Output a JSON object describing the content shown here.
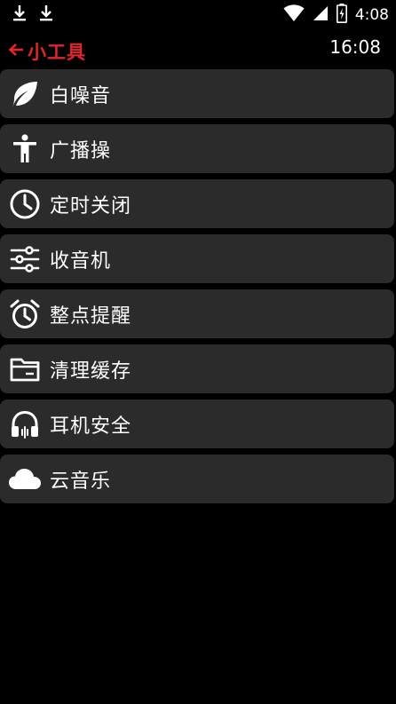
{
  "status_bar": {
    "time": "4:08",
    "left_icons": [
      "download-icon",
      "download-icon"
    ],
    "right_icons": [
      "wifi-icon",
      "battery-charging-icon"
    ]
  },
  "header": {
    "title": "小工具",
    "clock": "16:08",
    "accent_color": "#e0262b"
  },
  "items": [
    {
      "label": "白噪音",
      "icon": "leaf-icon"
    },
    {
      "label": "广播操",
      "icon": "person-icon"
    },
    {
      "label": "定时关闭",
      "icon": "clock-icon"
    },
    {
      "label": "收音机",
      "icon": "sliders-icon"
    },
    {
      "label": "整点提醒",
      "icon": "alarm-icon"
    },
    {
      "label": "清理缓存",
      "icon": "folder-icon"
    },
    {
      "label": "耳机安全",
      "icon": "headphones-icon"
    },
    {
      "label": "云音乐",
      "icon": "cloud-icon"
    }
  ]
}
